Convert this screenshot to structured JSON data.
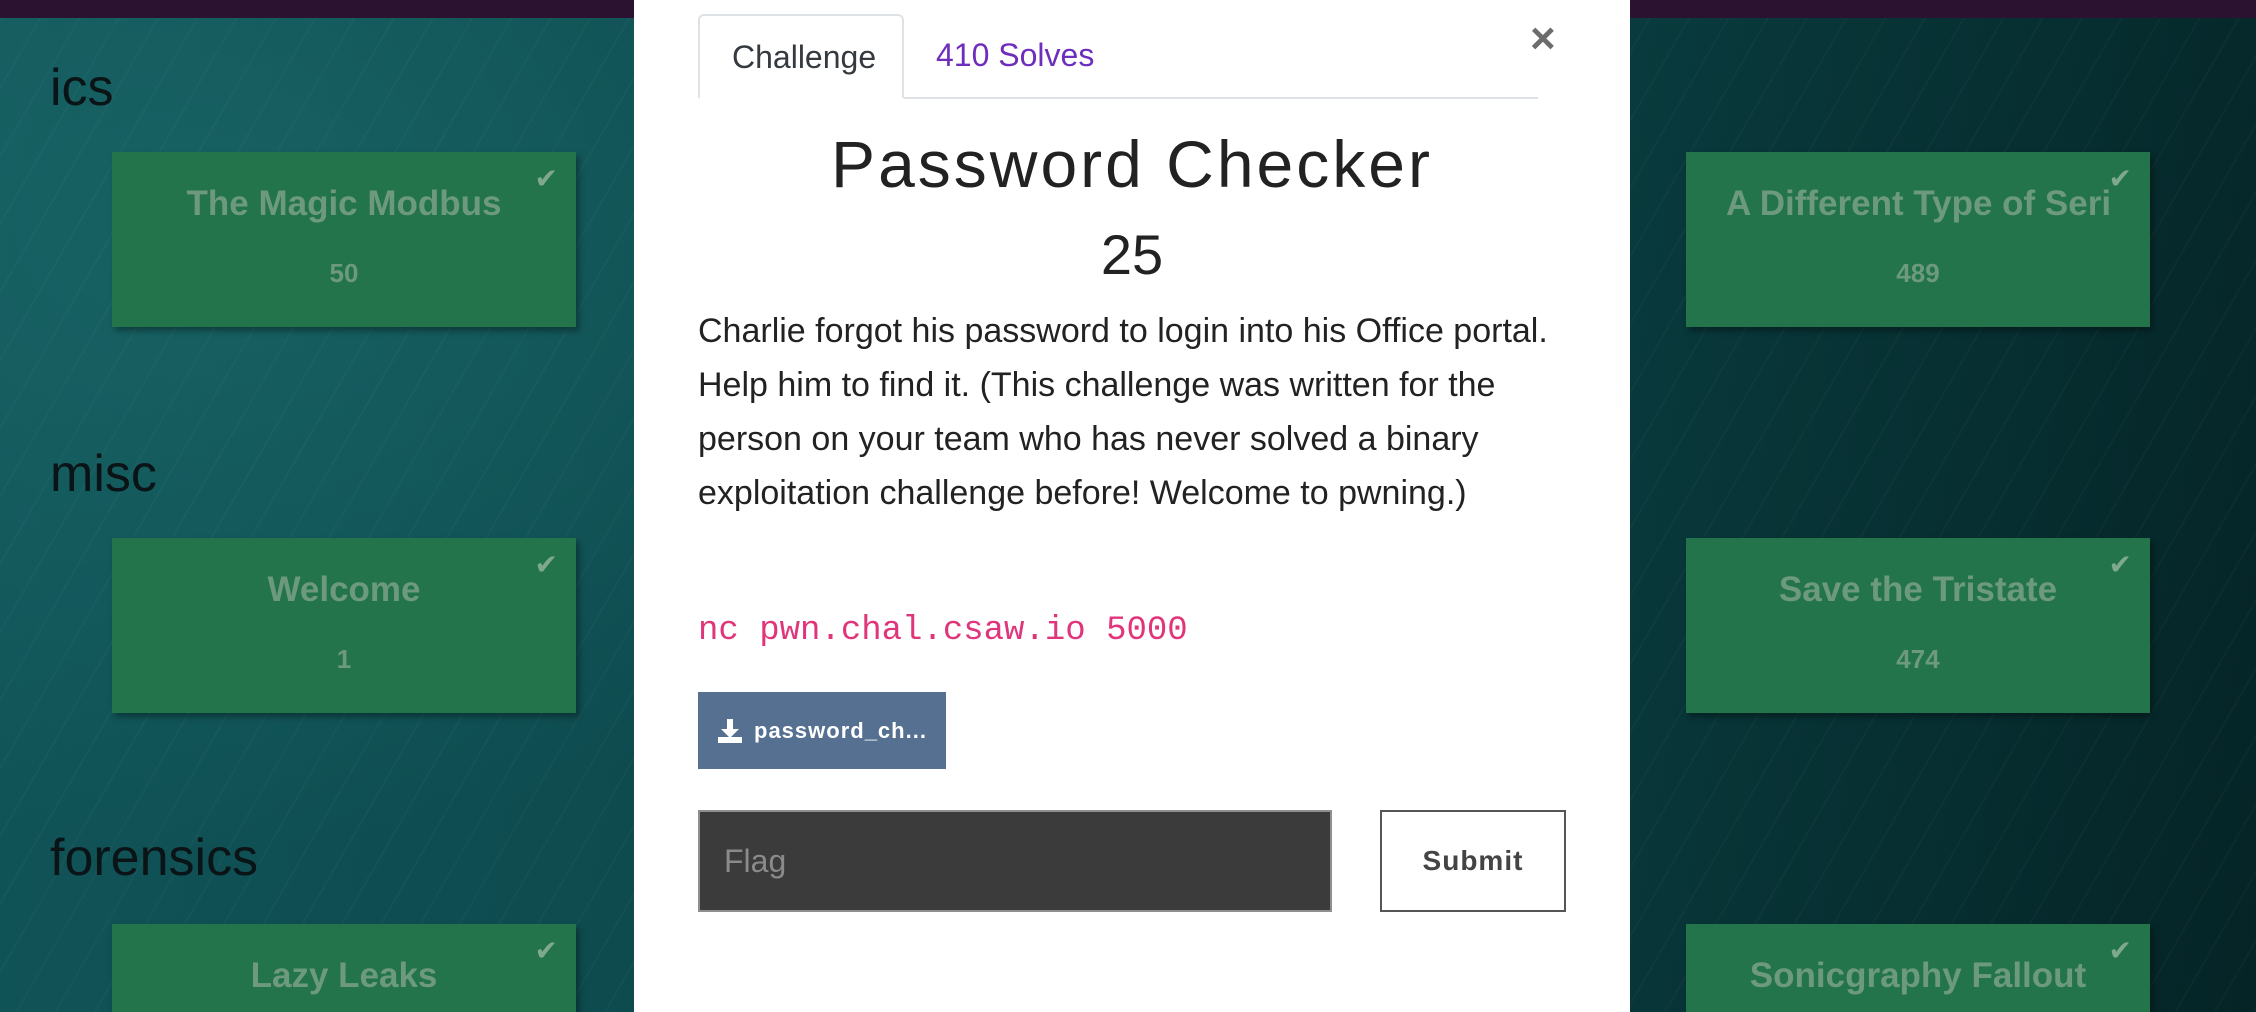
{
  "categories": [
    {
      "name": "ics",
      "left_challenges": [
        {
          "name": "The Magic Modbus",
          "points": "50"
        }
      ],
      "right_challenges": [
        {
          "name": "A Different Type of Seri",
          "points": "489"
        }
      ]
    },
    {
      "name": "misc",
      "left_challenges": [
        {
          "name": "Welcome",
          "points": "1"
        }
      ],
      "right_challenges": [
        {
          "name": "Save the Tristate",
          "points": "474"
        }
      ]
    },
    {
      "name": "forensics",
      "left_challenges": [
        {
          "name": "Lazy Leaks",
          "points": ""
        }
      ],
      "right_challenges": [
        {
          "name": "Sonicgraphy Fallout",
          "points": ""
        }
      ]
    }
  ],
  "modal": {
    "tabs": [
      {
        "label": "Challenge",
        "active": true
      },
      {
        "label": "410 Solves",
        "active": false
      }
    ],
    "close_label": "×",
    "title": "Password Checker",
    "value": "25",
    "description": "Charlie forgot his password to login into his Office portal. Help him to find it. (This challenge was written for the person on your team who has never solved a binary exploitation challenge before! Welcome to pwning.)",
    "connection": "nc pwn.chal.csaw.io 5000",
    "file_button": {
      "label": "password_ch...",
      "icon": "download-icon"
    },
    "flag_input": {
      "placeholder": "Flag",
      "value": ""
    },
    "submit_label": "Submit"
  },
  "colors": {
    "card_solved": "#23744a",
    "tab_link": "#6f2dbd",
    "connection_text": "#e0357a",
    "file_button": "#557091",
    "flag_input_bg": "#3b3b3b"
  }
}
